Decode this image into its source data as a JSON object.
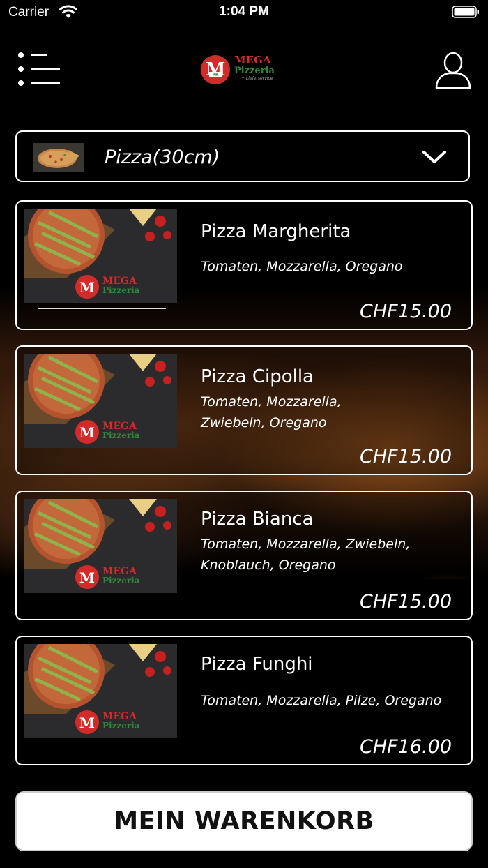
{
  "status_bar": {
    "carrier": "Carrier",
    "time": "1:04 PM"
  },
  "nav": {
    "logo_letter": "M",
    "logo_word1": "MEGA",
    "logo_word2": "Pizzeria",
    "logo_word3": "+ Lieferservice",
    "logo_badge": "PK"
  },
  "category": {
    "selected": "Pizza(30cm)"
  },
  "products": [
    {
      "name": "Pizza Margherita",
      "description": "Tomaten, Mozzarella, Oregano",
      "price": "CHF15.00"
    },
    {
      "name": "Pizza Cipolla",
      "description": "Tomaten, Mozzarella, Zwiebeln, Oregano",
      "price": "CHF15.00"
    },
    {
      "name": "Pizza Bianca",
      "description": "Tomaten, Mozzarella, Zwiebeln, Knoblauch, Oregano",
      "price": "CHF15.00"
    },
    {
      "name": "Pizza Funghi",
      "description": "Tomaten, Mozzarella, Pilze, Oregano",
      "price": "CHF16.00"
    }
  ],
  "cart": {
    "label": "MEIN WARENKORB"
  },
  "colors": {
    "background": "#000000",
    "logo_red": "#d32a2a",
    "logo_green": "#2e8b3a",
    "button_bg": "#ffffff"
  }
}
